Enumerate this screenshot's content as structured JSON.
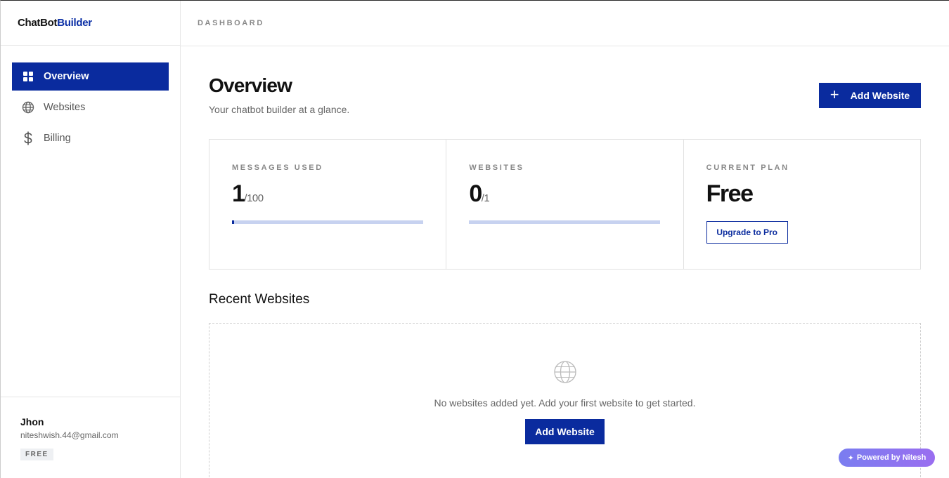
{
  "brand": {
    "part1": "ChatBot",
    "part2": "Builder"
  },
  "sidebar": {
    "items": [
      {
        "label": "Overview",
        "icon": "grid-icon",
        "active": true
      },
      {
        "label": "Websites",
        "icon": "globe-icon",
        "active": false
      },
      {
        "label": "Billing",
        "icon": "dollar-icon",
        "active": false
      }
    ]
  },
  "user": {
    "name": "Jhon",
    "email": "niteshwish.44@gmail.com",
    "plan": "FREE"
  },
  "topbar": {
    "breadcrumb": "DASHBOARD"
  },
  "header": {
    "title": "Overview",
    "subtitle": "Your chatbot builder at a glance.",
    "add_button": "Add Website",
    "add_icon": "+"
  },
  "stats": {
    "messages": {
      "label": "MESSAGES USED",
      "value": "1",
      "max": "/100",
      "progress": 0.01
    },
    "websites": {
      "label": "WEBSITES",
      "value": "0",
      "max": "/1",
      "progress": 0
    },
    "plan": {
      "label": "CURRENT PLAN",
      "value": "Free",
      "button": "Upgrade to Pro"
    }
  },
  "recent": {
    "title": "Recent Websites",
    "empty_message": "No websites added yet. Add your first website to get started.",
    "button": "Add Website"
  },
  "powered_badge": {
    "icon": "✦",
    "label": "Powered by Nitesh"
  },
  "colors": {
    "primary": "#0a2b9e",
    "progress_track": "#c7d2f0",
    "badge_gradient_start": "#7a7df0",
    "badge_gradient_end": "#9a6ef0"
  }
}
